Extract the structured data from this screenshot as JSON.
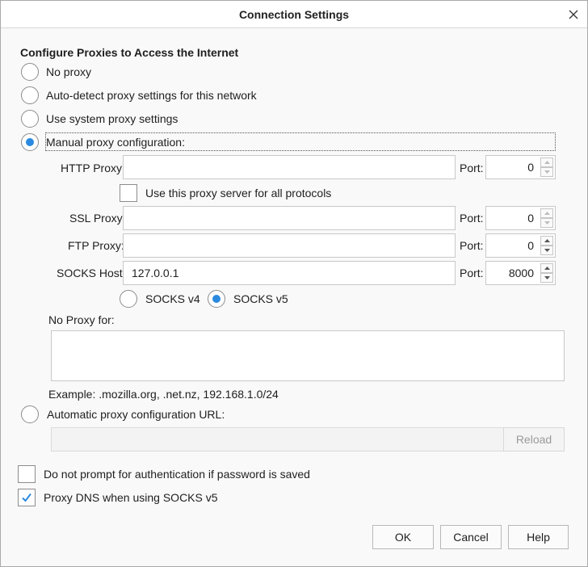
{
  "window": {
    "title": "Connection Settings"
  },
  "section_title": "Configure Proxies to Access the Internet",
  "proxy_modes": {
    "no_proxy": "No proxy",
    "auto_detect": "Auto-detect proxy settings for this network",
    "system": "Use system proxy settings",
    "manual": "Manual proxy configuration:",
    "selected": "manual"
  },
  "manual": {
    "http_label": "HTTP Proxy:",
    "http_value": "",
    "http_port": "0",
    "use_for_all_label": "Use this proxy server for all protocols",
    "ssl_label": "SSL Proxy:",
    "ssl_value": "",
    "ssl_port": "0",
    "ftp_label": "FTP Proxy:",
    "ftp_value": "",
    "ftp_port": "0",
    "socks_label": "SOCKS Host:",
    "socks_value": "127.0.0.1",
    "socks_port": "8000",
    "port_label": "Port:",
    "socks_v4": "SOCKS v4",
    "socks_v5": "SOCKS v5",
    "socks_selected": "v5"
  },
  "no_proxy_for": {
    "label": "No Proxy for:",
    "value": "",
    "example": "Example: .mozilla.org, .net.nz, 192.168.1.0/24"
  },
  "auto_config": {
    "label": "Automatic proxy configuration URL:",
    "value": "",
    "reload": "Reload"
  },
  "options": {
    "no_prompt_auth": "Do not prompt for authentication if password is saved",
    "no_prompt_auth_checked": false,
    "proxy_dns": "Proxy DNS when using SOCKS v5",
    "proxy_dns_checked": true
  },
  "buttons": {
    "ok": "OK",
    "cancel": "Cancel",
    "help": "Help"
  },
  "colors": {
    "accent": "#2b8ae0",
    "background": "#f9f9f9"
  },
  "icons": {
    "close": "close-icon",
    "spin_up": "chevron-up-icon",
    "spin_down": "chevron-down-icon",
    "check": "checkmark-icon"
  }
}
